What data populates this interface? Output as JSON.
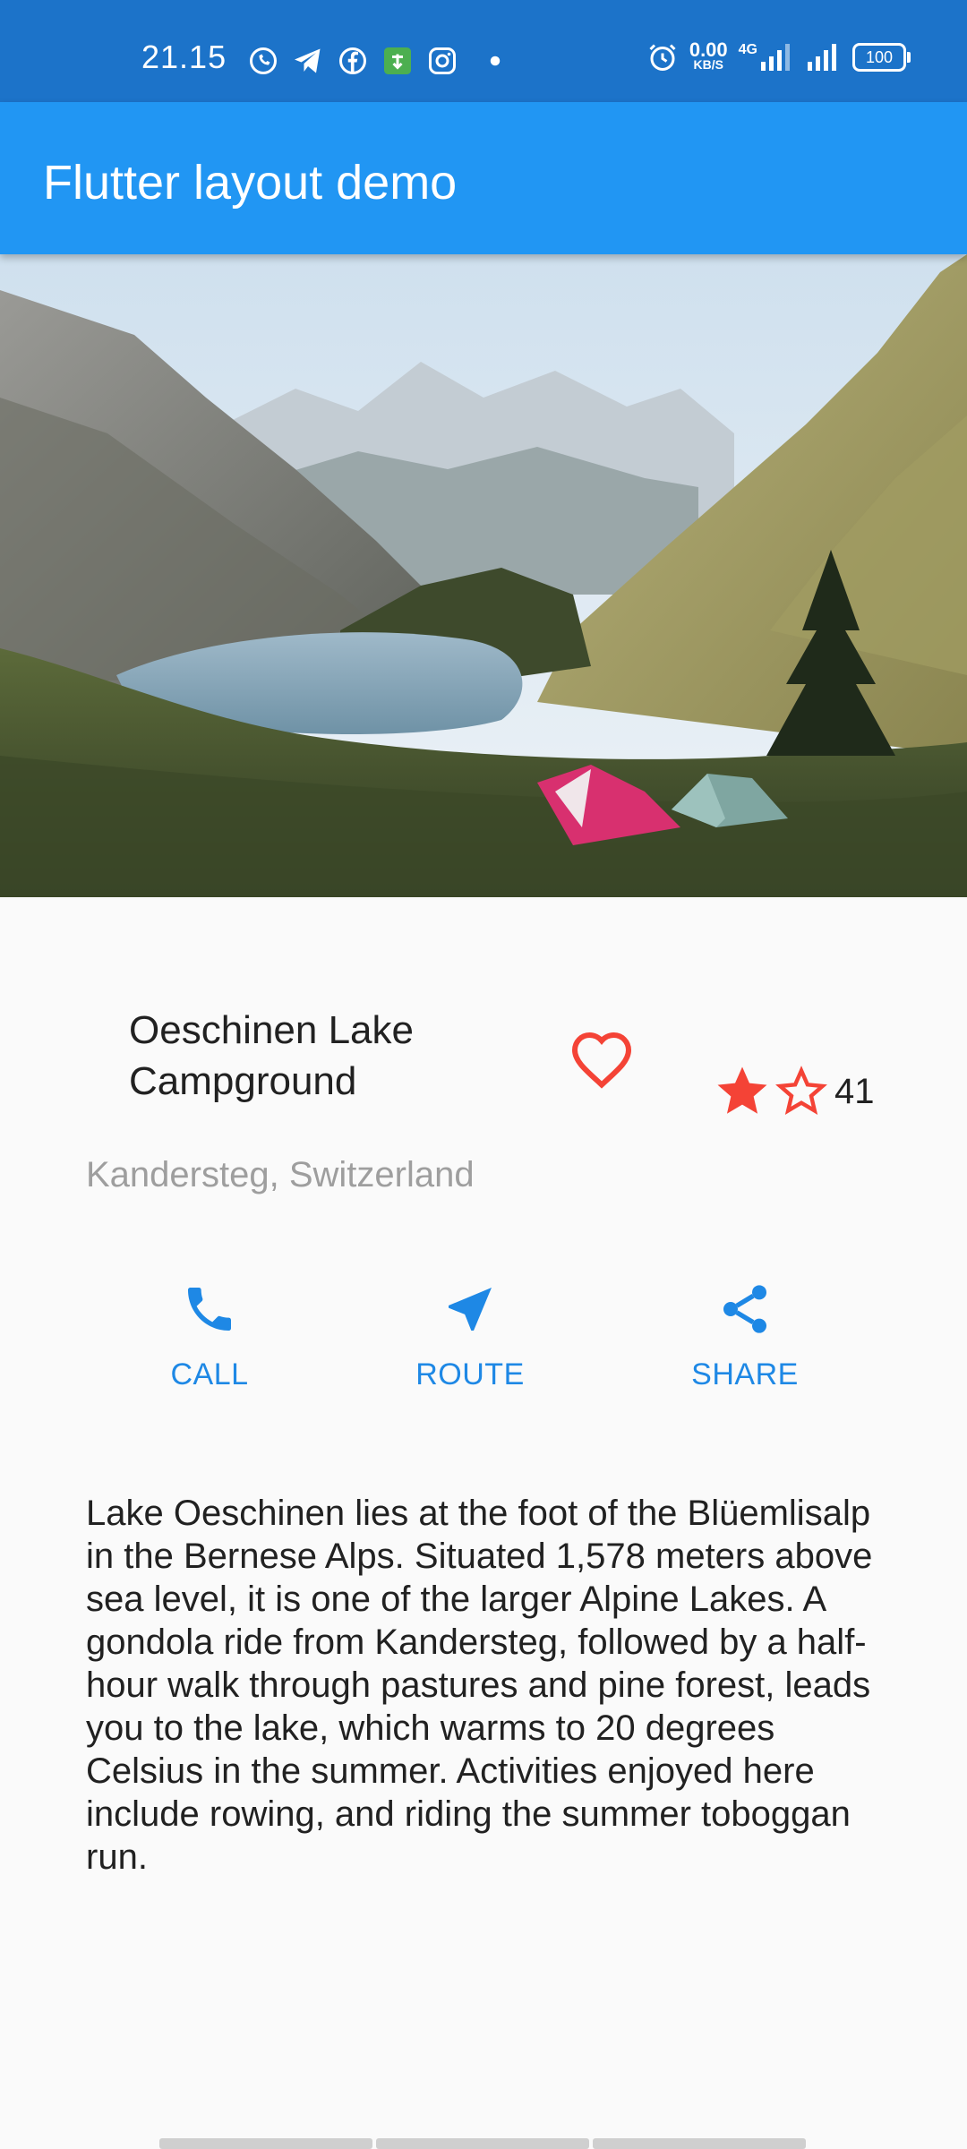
{
  "status_bar": {
    "time": "21.15",
    "icons_left": [
      "whatsapp-icon",
      "telegram-icon",
      "facebook-icon",
      "app-icon",
      "instagram-icon",
      "dot-icon"
    ],
    "net_speed_value": "0.00",
    "net_speed_unit": "KB/S",
    "network_type": "4G",
    "battery": "100"
  },
  "app_bar": {
    "title": "Flutter layout demo"
  },
  "place": {
    "name": "Oeschinen Lake Campground",
    "location": "Kandersteg, Switzerland",
    "rating_count": "41",
    "rating_filled": 1,
    "rating_total": 2
  },
  "actions": [
    {
      "label": "CALL",
      "icon": "phone-icon"
    },
    {
      "label": "ROUTE",
      "icon": "navigation-icon"
    },
    {
      "label": "SHARE",
      "icon": "share-icon"
    }
  ],
  "description": "Lake Oeschinen lies at the foot of the Blüemlisalp in the Bernese Alps. Situated 1,578 meters above sea level, it is one of the larger Alpine Lakes. A gondola ride from Kandersteg, followed by a half-hour walk through pastures and pine forest, leads you to the lake, which warms to 20 degrees Celsius in the summer. Activities enjoyed here include rowing, and riding the summer toboggan run.",
  "colors": {
    "status_bar": "#1c73c9",
    "app_bar": "#2196f3",
    "accent": "#1e88e5",
    "favorite": "#f44336"
  }
}
